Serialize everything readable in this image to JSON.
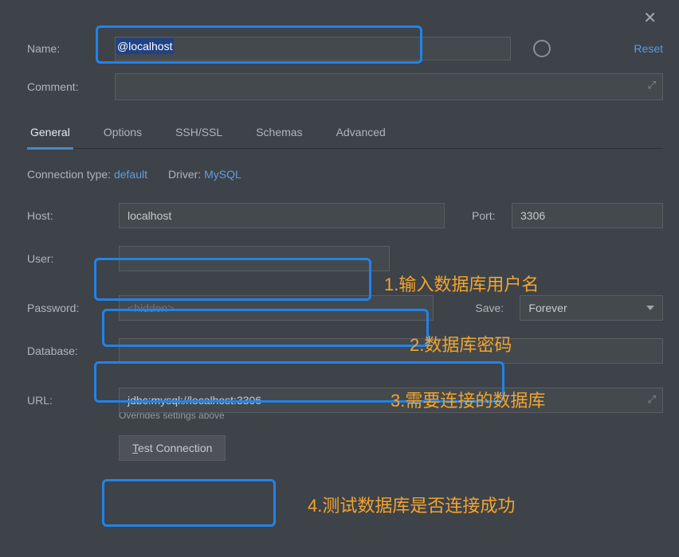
{
  "controls": {
    "close": "✕",
    "reset": "Reset"
  },
  "form": {
    "name_label": "Name:",
    "name_value": "@localhost",
    "comment_label": "Comment:",
    "comment_value": ""
  },
  "tabs": [
    "General",
    "Options",
    "SSH/SSL",
    "Schemas",
    "Advanced"
  ],
  "active_tab": "General",
  "connection": {
    "type_label": "Connection type:",
    "type_value": "default",
    "driver_label": "Driver:",
    "driver_value": "MySQL"
  },
  "fields": {
    "host_label": "Host:",
    "host_value": "localhost",
    "port_label": "Port:",
    "port_value": "3306",
    "user_label": "User:",
    "user_value": "",
    "password_label": "Password:",
    "password_placeholder": "<hidden>",
    "save_label": "Save:",
    "save_value": "Forever",
    "database_label": "Database:",
    "database_value": "",
    "url_label": "URL:",
    "url_value": "jdbc:mysql://localhost:3306",
    "url_hint": "Overrides settings above"
  },
  "buttons": {
    "test_connection": "Test Connection",
    "test_connection_underline": "T"
  },
  "annotations": {
    "a1": "1.输入数据库用户名",
    "a2": "2.数据库密码",
    "a3": "3.需要连接的数据库",
    "a4": "4.测试数据库是否连接成功"
  }
}
